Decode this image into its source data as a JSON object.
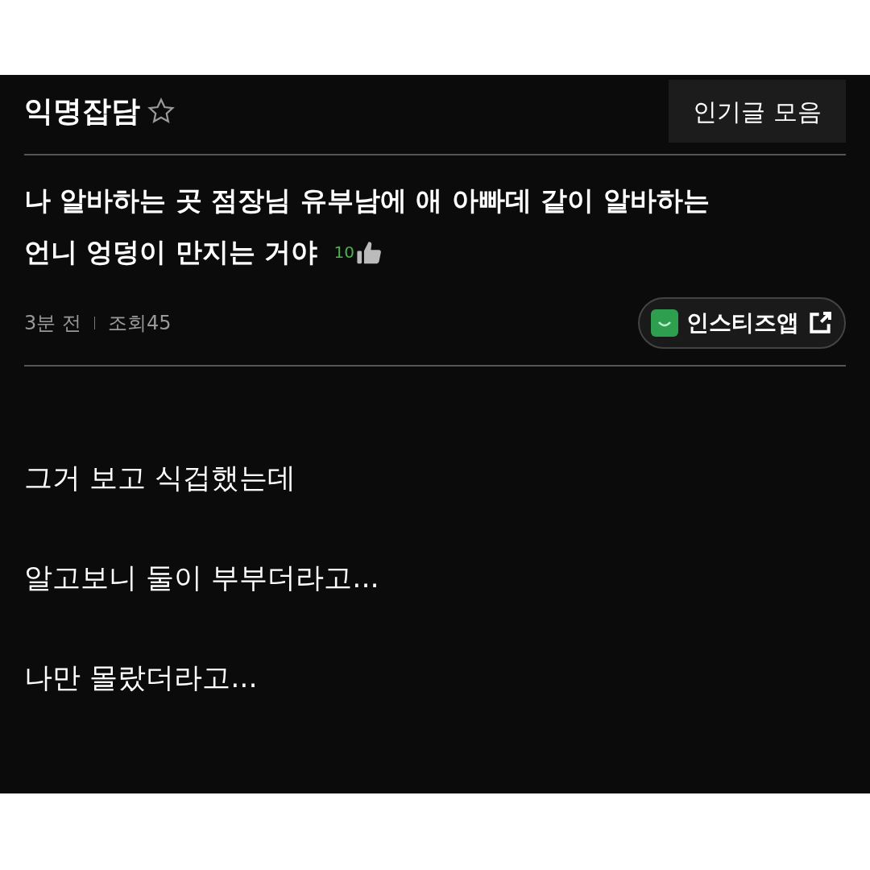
{
  "board": {
    "title": "익명잡담",
    "favorite": false
  },
  "popular_button": "인기글 모음",
  "post": {
    "title_lines": [
      "나 알바하는 곳 점장님 유부남에 애 아빠데 같이 알바하는",
      "언니 엉덩이 만지는 거야"
    ],
    "likes": "10",
    "time": "3분 전",
    "views": "조회45",
    "app_button": "인스티즈앱"
  },
  "body": [
    "그거 보고 식겁했는데",
    "알고보니 둘이 부부더라고...",
    "나만 몰랐더라고..."
  ]
}
